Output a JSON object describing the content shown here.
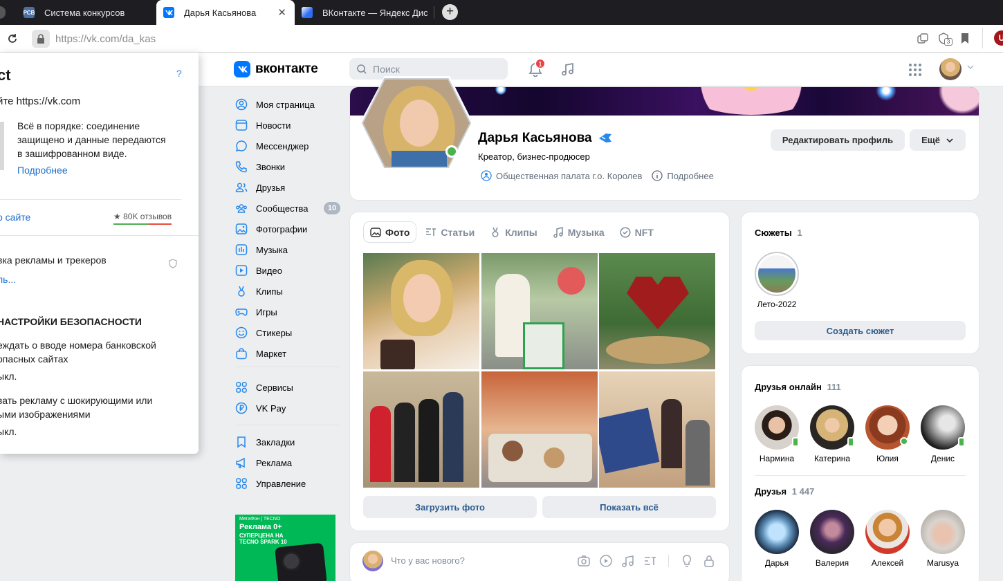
{
  "browser": {
    "tabs": [
      {
        "label": "Система конкурсов"
      },
      {
        "label": "Дарья Касьянова"
      },
      {
        "label": "ВКонтакте — Яндекс Дис"
      }
    ],
    "url_host": "https://vk.com",
    "url_path": "/da_kas",
    "counter_badge": "3"
  },
  "popup": {
    "title": "ct",
    "help": "?",
    "site_line": "йте https://vk.com",
    "secure_text_1": "Всё в порядке: соединение",
    "secure_text_2": "защищено и данные передаются",
    "secure_text_3": "в зашифрованном виде.",
    "more_link": "Подробнее",
    "about_site": "о сайте",
    "reviews": "80K отзывов",
    "ads_line": "вка рекламы и трекеров",
    "ads_more": "ль...",
    "settings_header": "НАСТРОЙКИ БЕЗОПАСНОСТИ",
    "warn_bank_1": "еждать о вводе номера банковской",
    "warn_bank_2": "опасных сайтах",
    "warn_bank_state": "ыкл.",
    "shock_ads_1": "вать рекламу с шокирующими или",
    "shock_ads_2": "ыми изображениями",
    "shock_ads_state": "ыкл."
  },
  "header": {
    "logo_text": "вконтакте",
    "search_placeholder": "Поиск",
    "notif_count": "1"
  },
  "nav": {
    "items": [
      {
        "label": "Моя страница",
        "icon": "user-circle-icon"
      },
      {
        "label": "Новости",
        "icon": "news-icon"
      },
      {
        "label": "Мессенджер",
        "icon": "message-icon"
      },
      {
        "label": "Звонки",
        "icon": "phone-icon"
      },
      {
        "label": "Друзья",
        "icon": "friends-icon"
      },
      {
        "label": "Сообщества",
        "icon": "communities-icon",
        "badge": "10"
      },
      {
        "label": "Фотографии",
        "icon": "photo-icon"
      },
      {
        "label": "Музыка",
        "icon": "music-icon"
      },
      {
        "label": "Видео",
        "icon": "video-icon"
      },
      {
        "label": "Клипы",
        "icon": "clips-icon"
      },
      {
        "label": "Игры",
        "icon": "gamepad-icon"
      },
      {
        "label": "Стикеры",
        "icon": "sticker-icon"
      },
      {
        "label": "Маркет",
        "icon": "market-icon"
      },
      {
        "label": "Сервисы",
        "icon": "services-icon"
      },
      {
        "label": "VK Pay",
        "icon": "vkpay-icon"
      },
      {
        "label": "Закладки",
        "icon": "bookmark-icon"
      },
      {
        "label": "Реклама",
        "icon": "megaphone-icon"
      },
      {
        "label": "Управление",
        "icon": "manage-icon"
      }
    ]
  },
  "ad": {
    "brand": "МегаФон | TECNO",
    "line1": "Реклама 0+",
    "line2": "СУПЕРЦЕНА НА",
    "line3": "TECNO SPARK 10"
  },
  "profile": {
    "name": "Дарья Касьянова",
    "status": "Креатор, бизнес-продюсер",
    "org": "Общественная палата г.о. Королев",
    "details": "Подробнее",
    "edit_btn": "Редактировать профиль",
    "more_btn": "Ещё"
  },
  "media_tabs": {
    "photo": "Фото",
    "articles": "Статьи",
    "clips": "Клипы",
    "music": "Музыка",
    "nft": "NFT"
  },
  "photos_actions": {
    "upload": "Загрузить фото",
    "show_all": "Показать всё"
  },
  "post_box": {
    "placeholder": "Что у вас нового?"
  },
  "stories": {
    "title": "Сюжеты",
    "count": "1",
    "story_label": "Лето-2022",
    "create_btn": "Создать сюжет"
  },
  "friends_online": {
    "title": "Друзья онлайн",
    "count": "111",
    "people": [
      "Нармина",
      "Катерина",
      "Юлия",
      "Денис"
    ]
  },
  "friends": {
    "title": "Друзья",
    "count": "1 447",
    "people": [
      "Дарья",
      "Валерия",
      "Алексей",
      "Marusya"
    ]
  },
  "colors": {
    "accent": "#0077ff",
    "link": "#2a5885",
    "online": "#4bb34b"
  }
}
